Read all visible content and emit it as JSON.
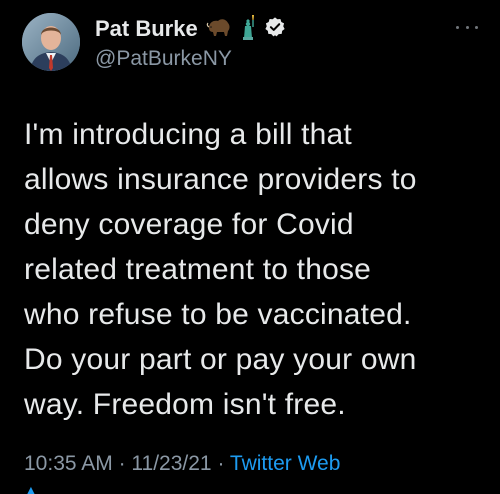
{
  "author": {
    "display_name": "Pat Burke",
    "handle": "@PatBurkeNY",
    "name_emojis": [
      "bison-emoji",
      "statue-of-liberty-emoji"
    ],
    "verified": true
  },
  "tweet": {
    "text_lines": [
      "I'm introducing a bill that",
      "allows insurance providers to",
      "deny coverage for Covid",
      "related treatment to those",
      "who refuse to be vaccinated.",
      "Do your part or pay your own",
      "way. Freedom isn't free."
    ],
    "time": "10:35 AM",
    "separator": "·",
    "date": "11/23/21",
    "source": "Twitter Web"
  },
  "colors": {
    "background": "#000000",
    "text": "#e7e9ea",
    "secondary": "#8b98a5",
    "accent": "#1d9bf0"
  },
  "icons": {
    "more": "more-options-icon",
    "verified": "verified-badge-icon"
  }
}
